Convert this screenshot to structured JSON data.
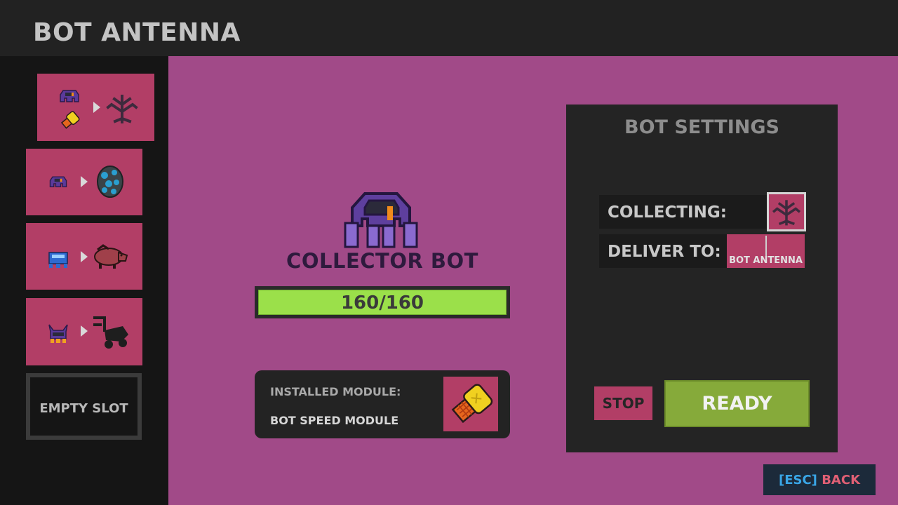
{
  "header": {
    "title": "BOT ANTENNA"
  },
  "sidebar": {
    "slots": [
      {
        "bot_icon": "purple-bot-icon",
        "module_icon": "speed-module-icon",
        "target_icon": "dark-plant-icon"
      },
      {
        "bot_icon": "purple-bot-icon",
        "target_icon": "blue-ore-icon"
      },
      {
        "bot_icon": "blue-bot-icon",
        "target_icon": "boar-icon"
      },
      {
        "bot_icon": "horned-bot-icon",
        "target_icon": "lawnmower-icon"
      }
    ],
    "empty_label": "EMPTY SLOT"
  },
  "bot": {
    "name": "COLLECTOR BOT",
    "health_text": "160/160",
    "health_fraction": 1.0,
    "icon": "collector-bot-icon"
  },
  "module": {
    "installed_label": "INSTALLED MODULE:",
    "name": "BOT SPEED MODULE",
    "icon": "speed-module-icon"
  },
  "settings": {
    "title": "BOT SETTINGS",
    "collecting_label": "COLLECTING:",
    "collecting_icon": "dark-plant-icon",
    "deliver_label": "DELIVER TO:",
    "deliver_target": "BOT ANTENNA",
    "stop_label": "STOP",
    "ready_label": "READY"
  },
  "footer": {
    "back_key": "[ESC]",
    "back_label": "BACK"
  },
  "colors": {
    "accent_pink": "#b23e66",
    "background": "#a14a88",
    "ready_green": "#86aa3a",
    "health_green": "#9be04a"
  }
}
